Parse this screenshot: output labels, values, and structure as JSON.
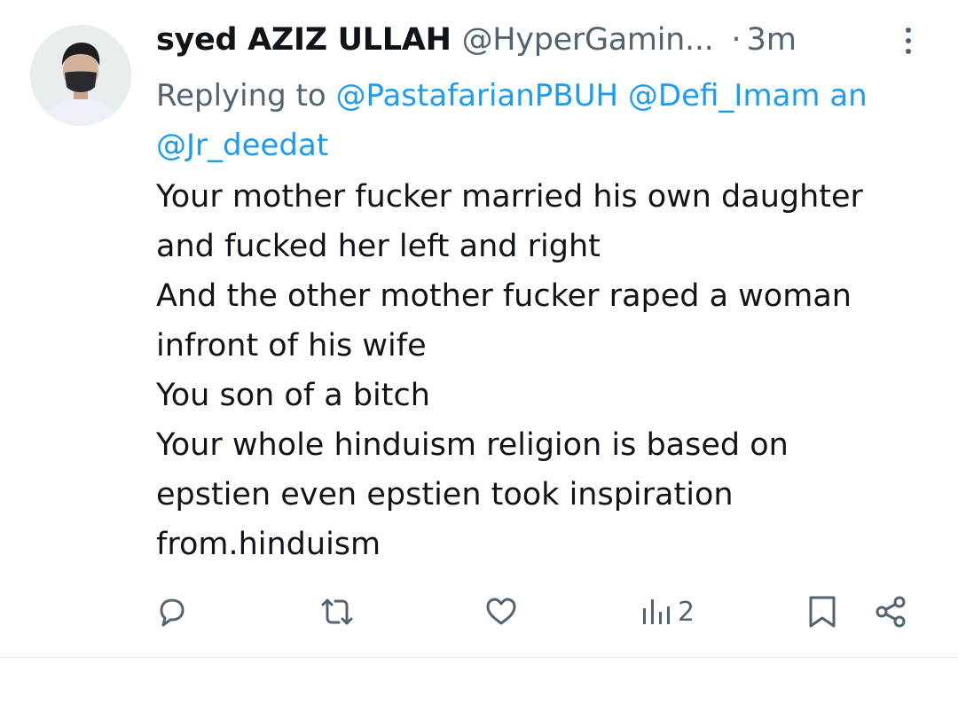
{
  "tweet": {
    "author_name": "syed AZIZ ULLAH",
    "author_handle": "@HyperGamin...",
    "separator": "·",
    "time": "3m",
    "reply_prefix": "Replying to",
    "mentions": [
      "@PastafarianPBUH",
      "@Defi_Imam an",
      "@Jr_deedat"
    ],
    "body_lines": [
      "Your mother fucker married his own daughter",
      "and fucked her left and right",
      "And the other mother fucker raped a woman",
      "infront of his wife",
      "You son of a bitch",
      "Your whole hinduism religion is based on",
      "epstien even epstien took inspiration",
      "from.hinduism"
    ]
  },
  "actions": {
    "reply_icon": "comment-bubble-icon",
    "retweet_icon": "retweet-icon",
    "like_icon": "heart-icon",
    "views_icon": "bar-chart-icon",
    "views_count": "2",
    "bookmark_icon": "bookmark-icon",
    "share_icon": "share-icon"
  },
  "colors": {
    "text": "#0f1419",
    "secondary": "#536471",
    "link": "#1d9bf0",
    "divider": "#dfe3e6"
  }
}
